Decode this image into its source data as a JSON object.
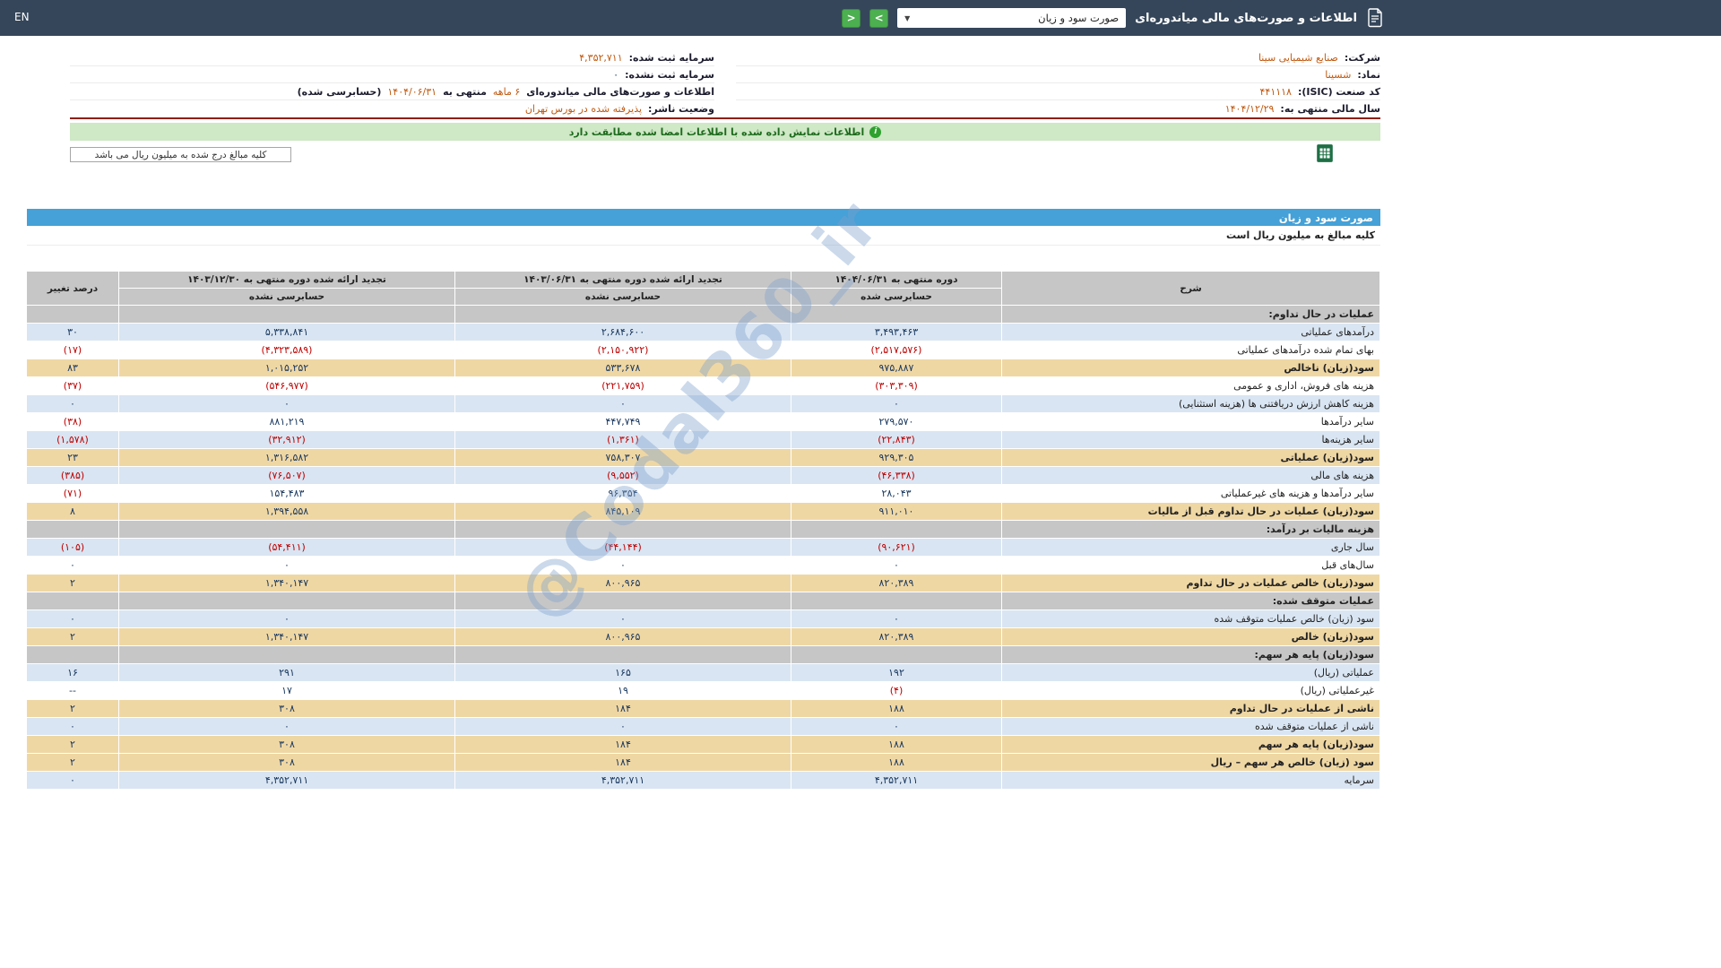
{
  "navbar": {
    "en_label": "EN",
    "title": "اطلاعات و صورت‌های مالی میاندوره‌ای",
    "dropdown_value": "صورت سود و زیان",
    "arrow_left": "<",
    "arrow_right": ">"
  },
  "company_info": {
    "right_rows": [
      {
        "parts": [
          {
            "text": "شرکت:",
            "kind": "label"
          },
          {
            "text": "صنایع شیمیایی سینا",
            "kind": "accent"
          }
        ]
      },
      {
        "parts": [
          {
            "text": "نماد:",
            "kind": "label"
          },
          {
            "text": "شسینا",
            "kind": "accent"
          }
        ]
      },
      {
        "parts": [
          {
            "text": "کد صنعت (ISIC):",
            "kind": "label"
          },
          {
            "text": "۴۴۱۱۱۸",
            "kind": "accent"
          }
        ]
      },
      {
        "parts": [
          {
            "text": "سال مالی منتهی به:",
            "kind": "label"
          },
          {
            "text": "۱۴۰۴/۱۲/۲۹",
            "kind": "accent"
          }
        ]
      }
    ],
    "left_rows": [
      {
        "parts": [
          {
            "text": "سرمایه ثبت شده:",
            "kind": "label"
          },
          {
            "text": "۴,۳۵۲,۷۱۱",
            "kind": "accent"
          }
        ]
      },
      {
        "parts": [
          {
            "text": "سرمایه ثبت نشده:",
            "kind": "label"
          },
          {
            "text": "۰",
            "kind": "plain"
          }
        ]
      },
      {
        "parts": [
          {
            "text": "اطلاعات و صورت‌های مالی میاندوره‌ای",
            "kind": "label"
          },
          {
            "text": "۶ ماهه",
            "kind": "accent"
          },
          {
            "text": "منتهی به",
            "kind": "label"
          },
          {
            "text": "۱۴۰۴/۰۶/۳۱",
            "kind": "accent"
          },
          {
            "text": "(حسابرسی شده)",
            "kind": "label"
          }
        ]
      },
      {
        "parts": [
          {
            "text": "وضعیت ناشر:",
            "kind": "label"
          },
          {
            "text": "پذیرفته شده در بورس تهران",
            "kind": "accent"
          }
        ]
      }
    ]
  },
  "notice": {
    "text": "اطلاعات نمایش داده شده با اطلاعات امضا شده مطابقت دارد"
  },
  "unit_box": {
    "text": "کلیه مبالغ درج شده به میلیون ریال می باشد"
  },
  "statement": {
    "title": "صورت سود و زیان",
    "unit_note": "کلیه مبالغ به میلیون ریال است",
    "headers": {
      "desc": "شرح",
      "period1": "دوره منتهی به ۱۴۰۴/۰۶/۳۱",
      "period1_sub": "حسابرسی شده",
      "period2": "تجدید ارائه شده دوره منتهی به ۱۴۰۳/۰۶/۳۱",
      "period2_sub": "حسابرسی نشده",
      "period3": "تجدید ارائه شده دوره منتهی به ۱۴۰۳/۱۲/۳۰",
      "period3_sub": "حسابرسی نشده",
      "change": "درصد تغییر"
    },
    "rows": [
      {
        "type": "section",
        "desc": "عملیات در حال تداوم:"
      },
      {
        "type": "data",
        "style": "blue",
        "desc": "درآمدهای عملیاتی",
        "c1": "۳,۴۹۳,۴۶۳",
        "c2": "۲,۶۸۴,۶۰۰",
        "c3": "۵,۳۳۸,۸۴۱",
        "chg": "۳۰"
      },
      {
        "type": "data",
        "style": "white",
        "desc": "بهای تمام شده درآمدهای عملیاتی",
        "c1": "(۲,۵۱۷,۵۷۶)",
        "c2": "(۲,۱۵۰,۹۲۲)",
        "c3": "(۴,۳۲۳,۵۸۹)",
        "chg": "(۱۷)"
      },
      {
        "type": "data",
        "style": "yellow",
        "desc": "سود(زیان) ناخالص",
        "c1": "۹۷۵,۸۸۷",
        "c2": "۵۳۳,۶۷۸",
        "c3": "۱,۰۱۵,۲۵۲",
        "chg": "۸۳"
      },
      {
        "type": "data",
        "style": "white",
        "desc": "هزینه های فروش، اداری و عمومی",
        "c1": "(۳۰۳,۳۰۹)",
        "c2": "(۲۲۱,۷۵۹)",
        "c3": "(۵۴۶,۹۷۷)",
        "chg": "(۳۷)"
      },
      {
        "type": "data",
        "style": "blue",
        "desc": "هزینه کاهش ارزش دریافتنی ها (هزینه استثنایی)",
        "c1": "۰",
        "c2": "۰",
        "c3": "۰",
        "chg": "۰"
      },
      {
        "type": "data",
        "style": "white",
        "desc": "سایر درآمدها",
        "c1": "۲۷۹,۵۷۰",
        "c2": "۴۴۷,۷۴۹",
        "c3": "۸۸۱,۲۱۹",
        "chg": "(۳۸)"
      },
      {
        "type": "data",
        "style": "blue",
        "desc": "سایر هزینه‌ها",
        "c1": "(۲۲,۸۴۳)",
        "c2": "(۱,۳۶۱)",
        "c3": "(۳۲,۹۱۲)",
        "chg": "(۱,۵۷۸)"
      },
      {
        "type": "data",
        "style": "yellow",
        "desc": "سود(زیان) عملیاتی",
        "c1": "۹۲۹,۳۰۵",
        "c2": "۷۵۸,۳۰۷",
        "c3": "۱,۳۱۶,۵۸۲",
        "chg": "۲۳"
      },
      {
        "type": "data",
        "style": "blue",
        "desc": "هزینه های مالی",
        "c1": "(۴۶,۳۳۸)",
        "c2": "(۹,۵۵۲)",
        "c3": "(۷۶,۵۰۷)",
        "chg": "(۳۸۵)"
      },
      {
        "type": "data",
        "style": "white",
        "desc": "سایر درآمدها و هزینه های غیرعملیاتی",
        "c1": "۲۸,۰۴۳",
        "c2": "۹۶,۳۵۴",
        "c3": "۱۵۴,۴۸۳",
        "chg": "(۷۱)"
      },
      {
        "type": "data",
        "style": "yellow",
        "desc": "سود(زیان) عملیات در حال تداوم قبل از مالیات",
        "c1": "۹۱۱,۰۱۰",
        "c2": "۸۴۵,۱۰۹",
        "c3": "۱,۳۹۴,۵۵۸",
        "chg": "۸"
      },
      {
        "type": "section",
        "desc": "هزینه مالیات بر درآمد:"
      },
      {
        "type": "data",
        "style": "blue",
        "desc": "سال جاری",
        "c1": "(۹۰,۶۲۱)",
        "c2": "(۴۴,۱۴۴)",
        "c3": "(۵۴,۴۱۱)",
        "chg": "(۱۰۵)"
      },
      {
        "type": "data",
        "style": "white",
        "desc": "سال‌های قبل",
        "c1": "۰",
        "c2": "۰",
        "c3": "۰",
        "chg": "۰"
      },
      {
        "type": "data",
        "style": "yellow",
        "desc": "سود(زیان) خالص عملیات در حال تداوم",
        "c1": "۸۲۰,۳۸۹",
        "c2": "۸۰۰,۹۶۵",
        "c3": "۱,۳۴۰,۱۴۷",
        "chg": "۲"
      },
      {
        "type": "section",
        "desc": "عملیات متوقف شده:"
      },
      {
        "type": "data",
        "style": "blue",
        "desc": "سود (زیان) خالص عملیات متوقف شده",
        "c1": "۰",
        "c2": "۰",
        "c3": "۰",
        "chg": "۰"
      },
      {
        "type": "data",
        "style": "yellow",
        "desc": "سود(زیان) خالص",
        "c1": "۸۲۰,۳۸۹",
        "c2": "۸۰۰,۹۶۵",
        "c3": "۱,۳۴۰,۱۴۷",
        "chg": "۲"
      },
      {
        "type": "section",
        "desc": "سود(زیان) پایه هر سهم:"
      },
      {
        "type": "data",
        "style": "blue",
        "desc": "عملیاتی (ریال)",
        "c1": "۱۹۲",
        "c2": "۱۶۵",
        "c3": "۲۹۱",
        "chg": "۱۶"
      },
      {
        "type": "data",
        "style": "white",
        "desc": "غیرعملیاتی (ریال)",
        "c1": "(۴)",
        "c2": "۱۹",
        "c3": "۱۷",
        "chg": "--"
      },
      {
        "type": "data",
        "style": "yellow",
        "desc": "ناشی از عملیات در حال تداوم",
        "c1": "۱۸۸",
        "c2": "۱۸۴",
        "c3": "۳۰۸",
        "chg": "۲"
      },
      {
        "type": "data",
        "style": "blue",
        "desc": "ناشی از عملیات متوقف شده",
        "c1": "۰",
        "c2": "۰",
        "c3": "۰",
        "chg": "۰"
      },
      {
        "type": "data",
        "style": "yellow",
        "desc": "سود(زیان) پایه هر سهم",
        "c1": "۱۸۸",
        "c2": "۱۸۴",
        "c3": "۳۰۸",
        "chg": "۲"
      },
      {
        "type": "data",
        "style": "yellow",
        "desc": "سود (زیان) خالص هر سهم – ریال",
        "c1": "۱۸۸",
        "c2": "۱۸۴",
        "c3": "۳۰۸",
        "chg": "۲"
      },
      {
        "type": "data",
        "style": "blue",
        "desc": "سرمایه",
        "c1": "۴,۳۵۲,۷۱۱",
        "c2": "۴,۳۵۲,۷۱۱",
        "c3": "۴,۳۵۲,۷۱۱",
        "chg": "۰"
      }
    ]
  },
  "watermark": "@Codal360_ir",
  "colors": {
    "navbar_bg": "#35465a",
    "accent_value": "#c05a11",
    "positive_value": "#17365d",
    "negative_value": "#c00000",
    "notice_bg": "#cfe8c6",
    "notice_text": "#1d6b1d",
    "table_title_bg": "#45a1d7",
    "header_gray": "#c6c6c6",
    "row_blue": "#d9e5f2",
    "row_yellow": "#efd7a4",
    "divider_red": "#8e1f12",
    "button_green": "#4caf50"
  }
}
